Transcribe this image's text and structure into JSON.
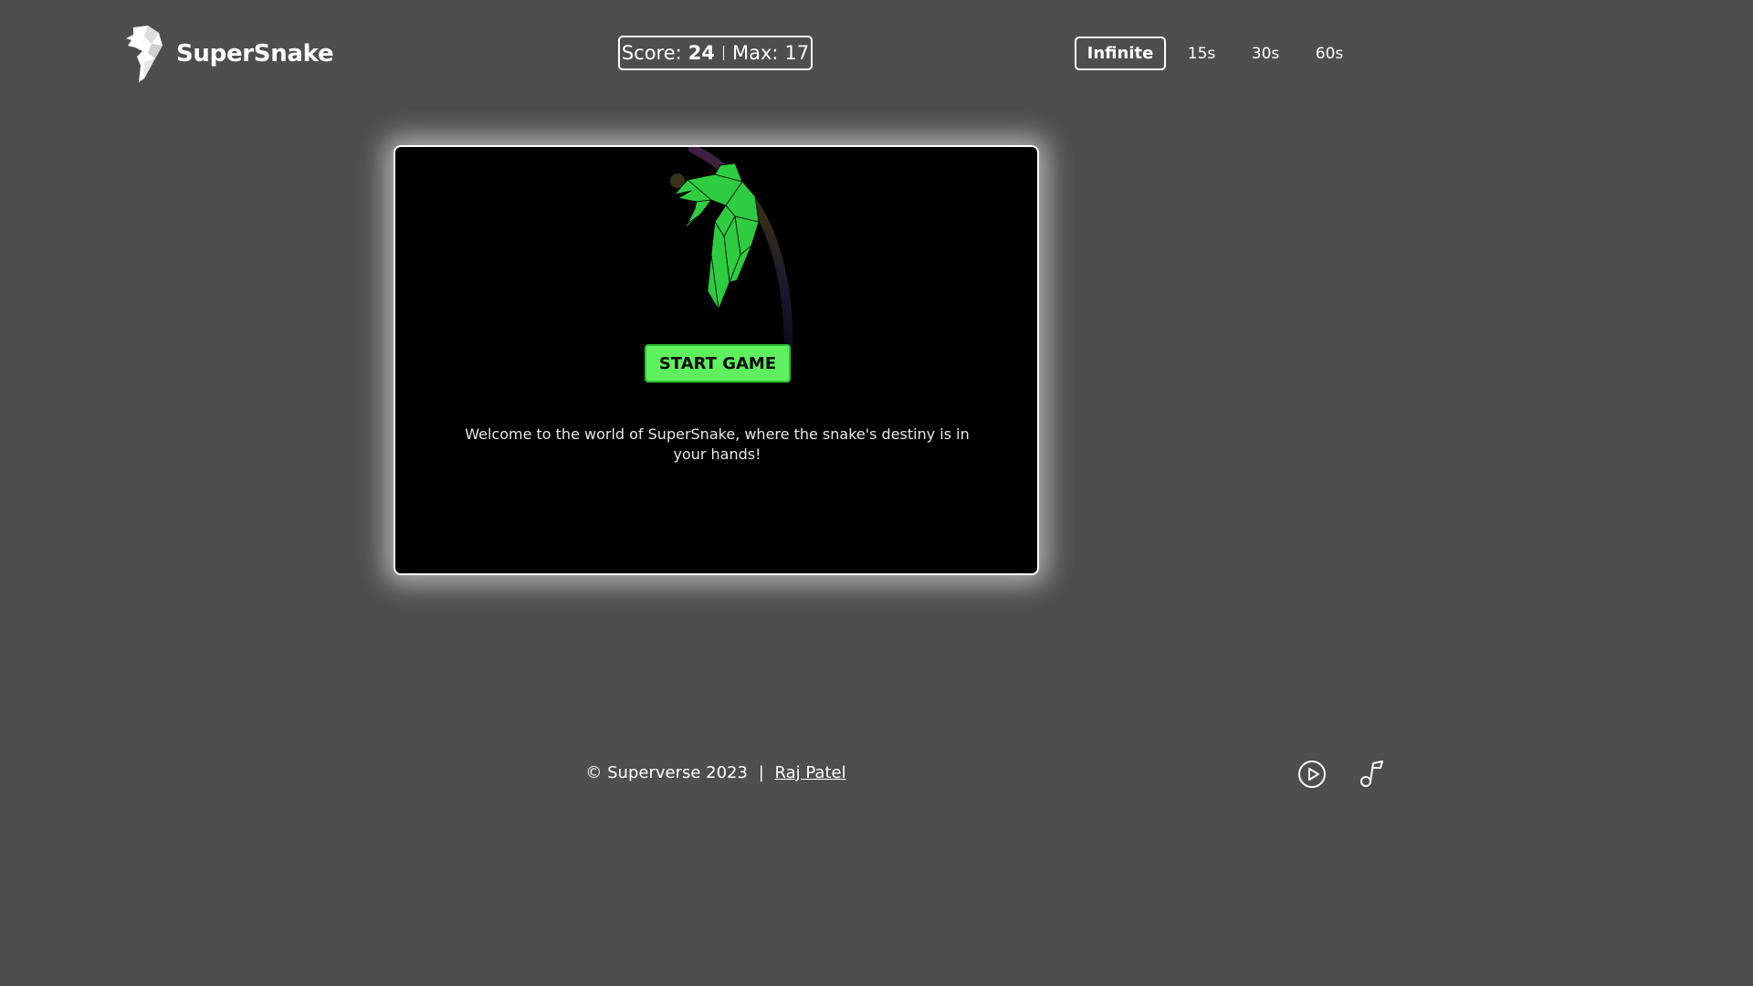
{
  "app": {
    "name": "SuperSnake"
  },
  "scoreboard": {
    "score_label": "Score:",
    "score_value": "24",
    "max_label": "Max:",
    "max_value": "17"
  },
  "modes": [
    {
      "label": "Infinite",
      "active": true
    },
    {
      "label": "15s",
      "active": false
    },
    {
      "label": "30s",
      "active": false
    },
    {
      "label": "60s",
      "active": false
    }
  ],
  "game": {
    "start_label": "START GAME",
    "welcome_text": "Welcome to the world of SuperSnake, where the snake's destiny is in your hands!"
  },
  "footer": {
    "copyright": "© Superverse 2023",
    "separator": "|",
    "author": "Raj Patel"
  },
  "controls": {
    "play_icon": "play-circle-icon",
    "music_icon": "music-note-icon"
  },
  "colors": {
    "background": "#4e4e4e",
    "panel": "#000000",
    "accent_green": "#5ef05e",
    "snake_green": "#2ecc40"
  }
}
